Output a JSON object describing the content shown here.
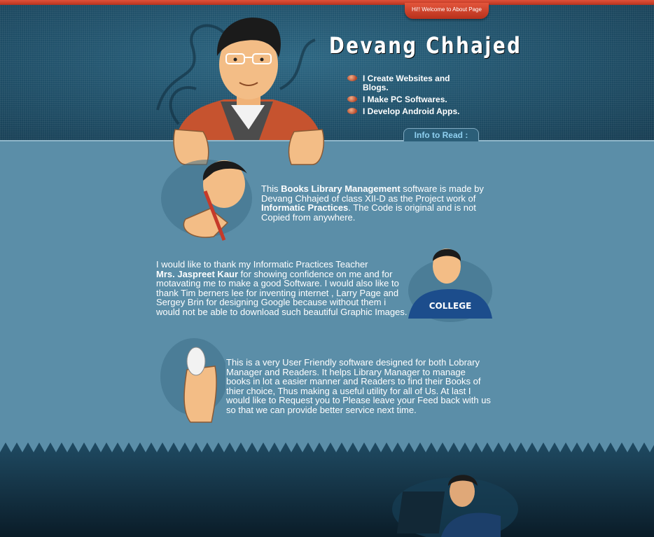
{
  "header": {
    "welcome_tab": "Hi!! Welcome to About Page",
    "name": "Devang Chhajed",
    "bullets": [
      {
        "icon": "football-icon",
        "text": "I Create Websites and Blogs."
      },
      {
        "icon": "football-icon",
        "text": "I Make PC Softwares."
      },
      {
        "icon": "football-icon",
        "text": "I Develop Android Apps."
      }
    ],
    "info_tab": "Info to Read :"
  },
  "content": {
    "p1": {
      "t1": "This ",
      "b1": "Books Library Management",
      "t2": " software is made by Devang Chhajed of class XII-D as the Project work of ",
      "b2": "Informatic Practices",
      "t3": ". The Code is original and is not Copied from anywhere."
    },
    "p2": {
      "t1": "I would like to thank my Informatic Practices Teacher",
      "b1": "Mrs. Jaspreet Kaur",
      "t2": " for showing confidence on me and for motavating me to make a good Software. I would also like to thank Tim berners lee for inventing internet , Larry Page and Sergey Brin for designing Google because without them i would not be able to download such beautiful Graphic Images."
    },
    "p3": {
      "t1": "This is a very User Friendly software designed for both Lobrary Manager and Readers. It helps Library Manager to manage books in lot a easier manner and Readers to find their Books of thier choice, Thus making a useful utility for all of Us. At last I would like to Request you to Please leave your Feed back with us so that we can provide better service next time."
    },
    "college_shirt": "COLLEGE"
  },
  "colors": {
    "accent_red": "#c9402a",
    "header_bg": "#1f4f68",
    "body_bg": "#5b8ea8",
    "footer_bg": "#0f2a3a",
    "info_tab_text": "#8fd0f0"
  }
}
